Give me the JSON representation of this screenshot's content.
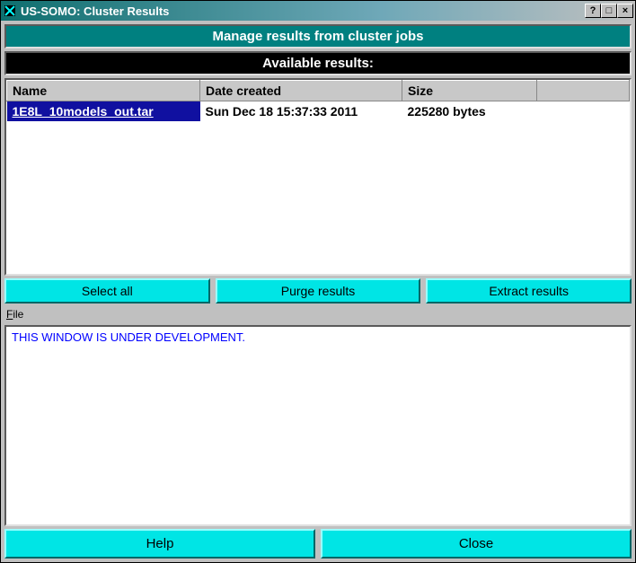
{
  "window": {
    "title": "US-SOMO: Cluster Results"
  },
  "banners": {
    "manage": "Manage results from cluster jobs",
    "available": "Available results:"
  },
  "table": {
    "headers": {
      "name": "Name",
      "date": "Date created",
      "size": "Size",
      "extra": ""
    },
    "rows": [
      {
        "name": "1E8L_10models_out.tar",
        "date": "Sun Dec 18 15:37:33 2011",
        "size": "225280 bytes",
        "selected": true
      }
    ]
  },
  "buttons": {
    "select_all": "Select all",
    "purge": "Purge results",
    "extract": "Extract results",
    "help": "Help",
    "close": "Close"
  },
  "menubar": {
    "file": "File",
    "file_underline": "F",
    "file_rest": "ile"
  },
  "log": {
    "text": "THIS WINDOW IS UNDER DEVELOPMENT."
  },
  "titlebar_controls": {
    "help": "?",
    "max": "□",
    "close": "×"
  }
}
